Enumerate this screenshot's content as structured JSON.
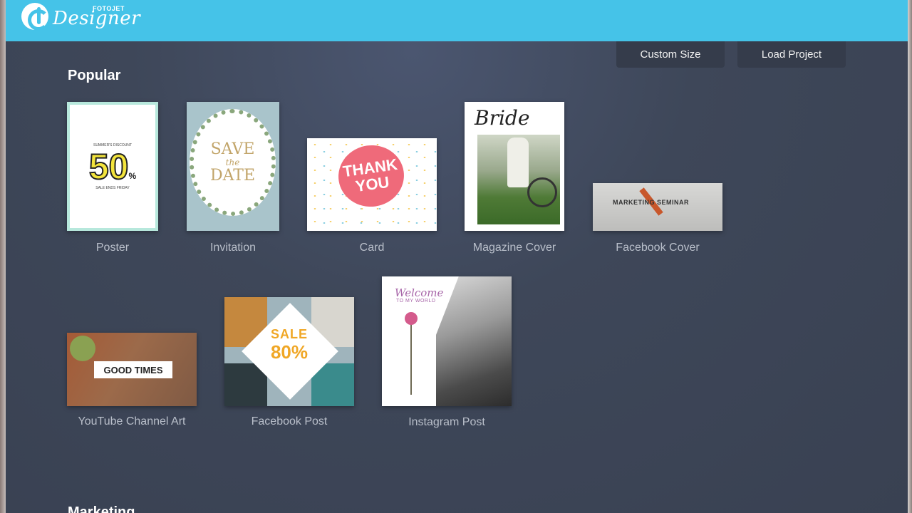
{
  "app": {
    "brand": "FOTOJET",
    "name": "Designer"
  },
  "toolbar": {
    "custom_size_label": "Custom Size",
    "load_project_label": "Load Project"
  },
  "sections": {
    "popular": "Popular",
    "marketing": "Marketing"
  },
  "templates": {
    "poster": {
      "label": "Poster",
      "thumb": {
        "line1": "SUMMER'S DISCOUNT",
        "big": "50",
        "pct": "%",
        "line2": "SALE ENDS FRIDAY"
      }
    },
    "invitation": {
      "label": "Invitation",
      "thumb": {
        "save": "SAVE",
        "the": "the",
        "date": "DATE"
      }
    },
    "card": {
      "label": "Card",
      "thumb": {
        "main": "THANK YOU"
      }
    },
    "magazine_cover": {
      "label": "Magazine Cover",
      "thumb": {
        "title": "Bride"
      }
    },
    "facebook_cover": {
      "label": "Facebook Cover",
      "thumb": {
        "text": "MARKETING    SEMINAR"
      }
    },
    "youtube_channel_art": {
      "label": "YouTube Channel Art",
      "thumb": {
        "text": "GOOD TIMES"
      }
    },
    "facebook_post": {
      "label": "Facebook Post",
      "thumb": {
        "sale": "SALE",
        "pct": "80%"
      }
    },
    "instagram_post": {
      "label": "Instagram Post",
      "thumb": {
        "welcome": "Welcome",
        "sub": "TO MY WORLD"
      }
    }
  },
  "colors": {
    "topbar": "#45c3e8",
    "background": "#3e4759",
    "button_bg": "#353c4b",
    "label_text": "#b9bfca"
  }
}
